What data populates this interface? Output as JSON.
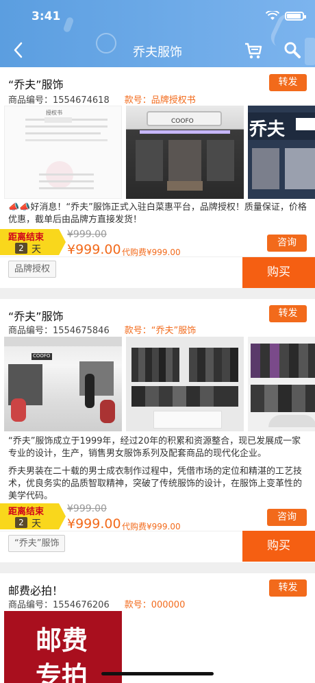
{
  "status": {
    "time": "3:41"
  },
  "nav": {
    "title": "乔夫服饰"
  },
  "colors": {
    "accent": "#f26a1b",
    "buy": "#f55f12",
    "countdown": "#f9d71c"
  },
  "products": [
    {
      "title": "“乔夫”服饰",
      "forward_label": "转发",
      "code_label": "商品编号：1554674618",
      "style_label": "款号：品牌授权书",
      "description": "📣📣好消息！“乔夫”服饰正式入驻白菜惠平台，品牌授权！质量保证，价格优惠，截单后由品牌方直接发货！",
      "countdown": {
        "label": "距离结束",
        "days": "2",
        "unit": "天"
      },
      "old_price": "¥999.00",
      "price": "¥999.00",
      "agent_fee": "代购费¥999.00",
      "consult_label": "咨询",
      "tag": "品牌授权",
      "buy_label": "购买",
      "images": [
        "授权书",
        "COOFO",
        "乔夫"
      ]
    },
    {
      "title": "“乔夫”服饰",
      "forward_label": "转发",
      "code_label": "商品编号：1554675846",
      "style_label": "款号：“乔夫”服饰",
      "description_1": "“乔夫”服饰成立于1999年，经过20年的积累和资源整合，现已发展成一家专业的设计，生产，销售男女服饰系列及配套商品的现代化企业。",
      "description_2": "乔夫男装在二十载的男士成衣制作过程中，凭借市场的定位和精湛的工艺技术，优良务实的品质智取精神，突破了传统服饰的设计，在服饰上变革性的美学代码。",
      "countdown": {
        "label": "距离结束",
        "days": "2",
        "unit": "天"
      },
      "old_price": "¥999.00",
      "price": "¥999.00",
      "agent_fee": "代购费¥999.00",
      "consult_label": "咨询",
      "tag": "“乔夫”服饰",
      "buy_label": "购买",
      "images": [
        "COOFO"
      ]
    },
    {
      "title": "邮费必拍！",
      "forward_label": "转发",
      "code_label": "商品编号：1554676206",
      "style_label": "款号：000000",
      "banner_text": [
        "邮费",
        "专拍"
      ]
    }
  ]
}
